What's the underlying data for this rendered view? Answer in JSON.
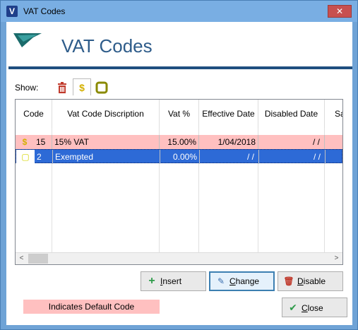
{
  "window": {
    "title": "VAT Codes",
    "close_glyph": "✕"
  },
  "header": {
    "title": "VAT Codes"
  },
  "filter": {
    "label": "Show:",
    "buttons": [
      {
        "icon": "trash-icon"
      },
      {
        "icon": "dollar-icon",
        "glyph": "$"
      },
      {
        "icon": "square-outline-icon"
      }
    ]
  },
  "grid": {
    "columns": [
      "Code",
      "Vat Code Discription",
      "Vat %",
      "Effective Date",
      "Disabled Date",
      "Sa"
    ],
    "rows": [
      {
        "icon": "$",
        "code": "15",
        "description": "15% VAT",
        "vat": "15.00%",
        "effective": "1/04/2018",
        "disabled": "/ /",
        "style": "default"
      },
      {
        "icon": "▢",
        "code": "2",
        "description": "Exempted",
        "vat": "0.00%",
        "effective": "/ /",
        "disabled": "/ /",
        "style": "selected"
      }
    ],
    "scroll_left": "<",
    "scroll_right": ">"
  },
  "buttons": {
    "insert": {
      "prefix": "I",
      "rest": "nsert"
    },
    "change": {
      "prefix": "C",
      "rest": "hange"
    },
    "disable": {
      "prefix": "D",
      "rest": "isable"
    },
    "close": {
      "prefix": "C",
      "rest": "lose"
    }
  },
  "legend": {
    "text": "Indicates Default Code"
  },
  "colors": {
    "default_row": "#ffc0c0",
    "selected_row": "#2d6ad6",
    "header_rule": "#1f4f7f",
    "title_blue": "#2e5c8a"
  }
}
